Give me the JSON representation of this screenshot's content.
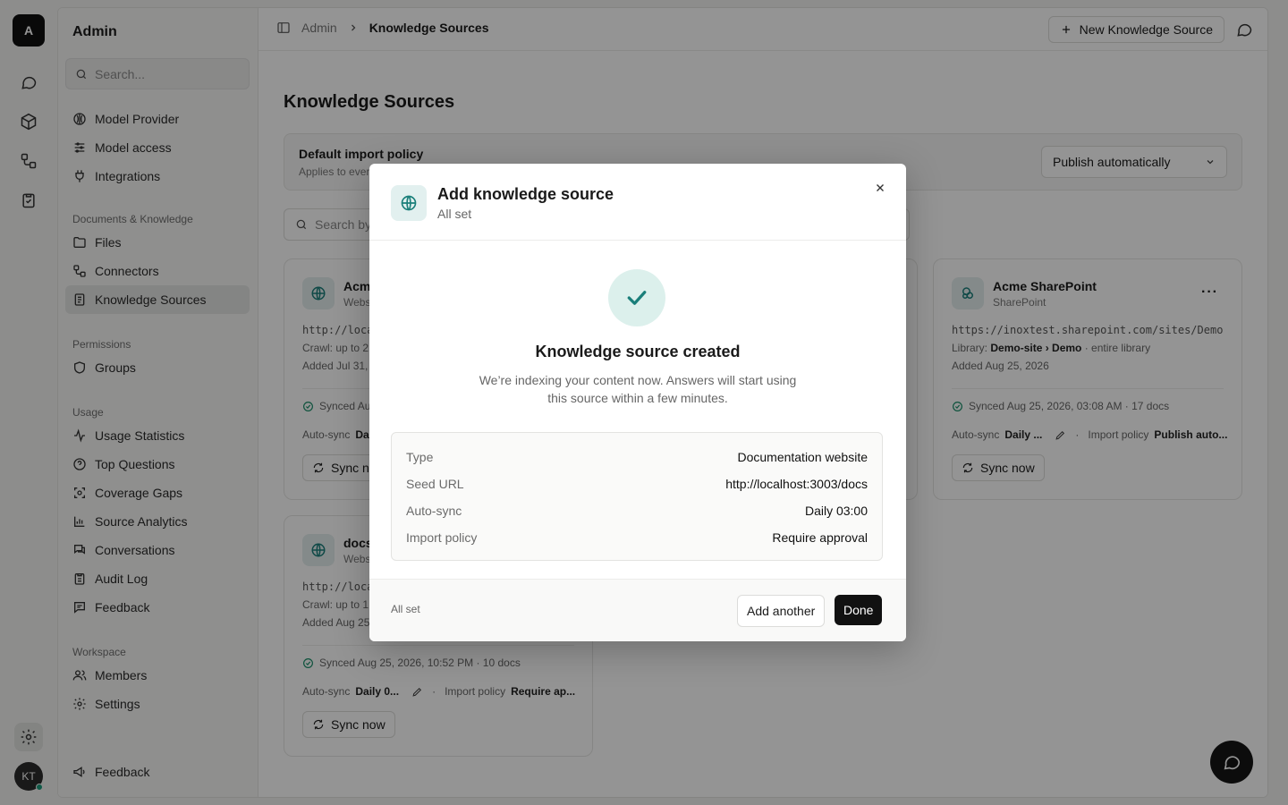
{
  "rail": {
    "logo": "A",
    "avatar": "KT"
  },
  "sidebar": {
    "title": "Admin",
    "search_placeholder": "Search...",
    "groups": [
      {
        "heading": "",
        "items": [
          {
            "label": "Model Provider",
            "icon": "model-provider-icon"
          },
          {
            "label": "Model access",
            "icon": "sliders-icon"
          },
          {
            "label": "Integrations",
            "icon": "plug-icon"
          }
        ]
      },
      {
        "heading": "Documents & Knowledge",
        "items": [
          {
            "label": "Files",
            "icon": "folder-icon"
          },
          {
            "label": "Connectors",
            "icon": "connectors-icon"
          },
          {
            "label": "Knowledge Sources",
            "icon": "book-icon",
            "active": true
          }
        ]
      },
      {
        "heading": "Permissions",
        "items": [
          {
            "label": "Groups",
            "icon": "shield-icon"
          }
        ]
      },
      {
        "heading": "Usage",
        "items": [
          {
            "label": "Usage Statistics",
            "icon": "activity-icon"
          },
          {
            "label": "Top Questions",
            "icon": "help-circle-icon"
          },
          {
            "label": "Coverage Gaps",
            "icon": "scan-icon"
          },
          {
            "label": "Source Analytics",
            "icon": "bar-chart-icon"
          },
          {
            "label": "Conversations",
            "icon": "chats-icon"
          },
          {
            "label": "Audit Log",
            "icon": "clipboard-icon"
          },
          {
            "label": "Feedback",
            "icon": "message-square-icon"
          }
        ]
      },
      {
        "heading": "Workspace",
        "items": [
          {
            "label": "Members",
            "icon": "users-icon"
          },
          {
            "label": "Settings",
            "icon": "gear-icon"
          }
        ]
      }
    ],
    "footer_feedback": "Feedback"
  },
  "topbar": {
    "breadcrumb_root": "Admin",
    "breadcrumb_current": "Knowledge Sources",
    "new_button": "New Knowledge Source"
  },
  "page": {
    "title": "Knowledge Sources",
    "policy_title": "Default import policy",
    "policy_sub": "Applies to ever",
    "policy_value": "Publish automatically",
    "search_placeholder": "Search by"
  },
  "cards": [
    {
      "name": "Acm",
      "type": "Webs",
      "url": "http://loca",
      "line2": "Crawl: up to 2",
      "line3": "Added Jul 31,",
      "sync": "Synced Au",
      "auto_label": "Auto-sync",
      "auto_value": "Da",
      "sync_button": "Sync no"
    },
    {
      "name": "Acme SharePoint",
      "type": "SharePoint",
      "url": "https://inoxtest.sharepoint.com/sites/Demo",
      "line2_pre": "Library: ",
      "line2_bold": "Demo-site › Demo",
      "line2_post": " · entire library",
      "line3": "Added Aug 25, 2026",
      "sync": "Synced Aug 25, 2026, 03:08 AM · 17 docs",
      "auto_label": "Auto-sync",
      "auto_value": "Daily ...",
      "policy_label": "Import policy",
      "policy_value": "Publish auto...",
      "sync_button": "Sync now"
    },
    {
      "name": "docs",
      "type": "Webs",
      "url": "http://loca",
      "line2": "Crawl: up to 1",
      "line3": "Added Aug 25",
      "sync": "Synced Aug 25, 2026, 10:52 PM · 10 docs",
      "auto_label": "Auto-sync",
      "auto_value": "Daily 0...",
      "policy_label": "Import policy",
      "policy_value": "Require ap...",
      "sync_button": "Sync now"
    }
  ],
  "modal": {
    "title": "Add knowledge source",
    "subtitle": "All set",
    "heading": "Knowledge source created",
    "body": "We’re indexing your content now. Answers will start using this source within a few minutes.",
    "summary": [
      {
        "key": "Type",
        "value": "Documentation website"
      },
      {
        "key": "Seed URL",
        "value": "http://localhost:3003/docs"
      },
      {
        "key": "Auto-sync",
        "value": "Daily 03:00"
      },
      {
        "key": "Import policy",
        "value": "Require approval"
      }
    ],
    "footer_status": "All set",
    "add_another": "Add another",
    "done": "Done"
  },
  "colors": {
    "accent": "#1a7f7a",
    "primary_button": "#111111",
    "success_bg": "#dcf0ec"
  }
}
